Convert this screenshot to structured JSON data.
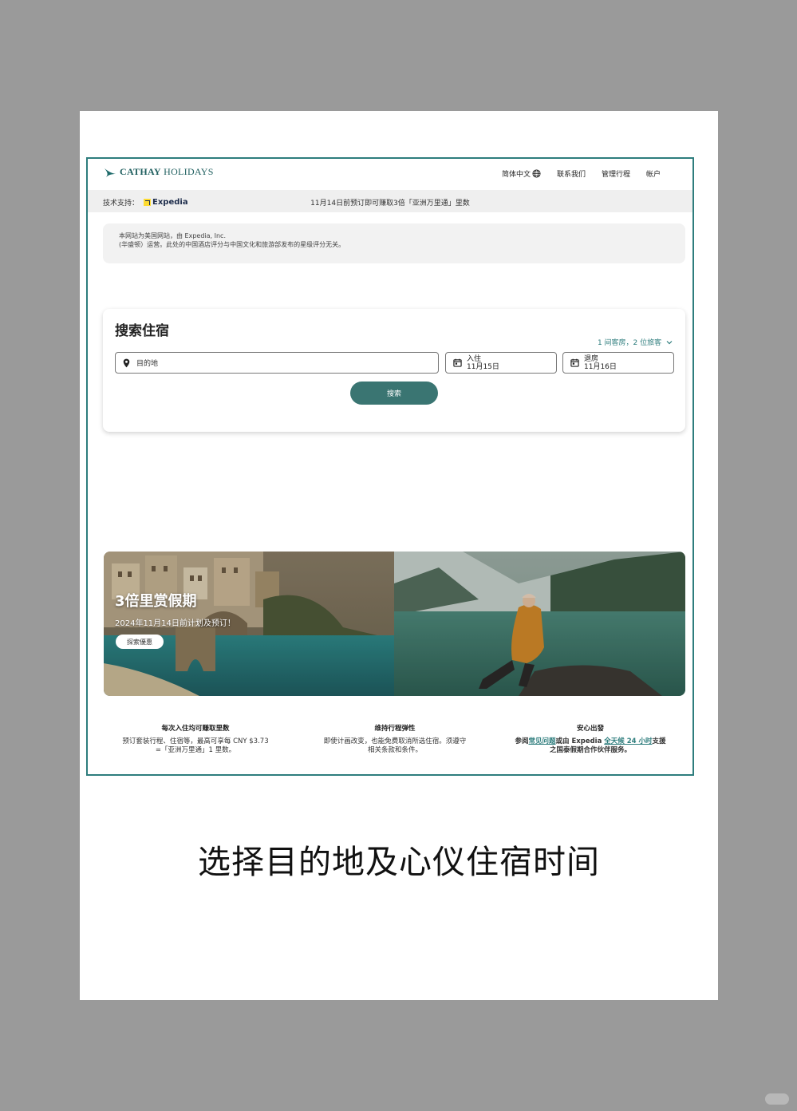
{
  "header": {
    "logo_bold": "CATHAY",
    "logo_rest": " HOLIDAYS",
    "nav": {
      "language": "简体中文",
      "contact": "联系我们",
      "manage": "管理行程",
      "account": "帐户"
    }
  },
  "subbar": {
    "powered_by": "技术支持：",
    "partner": "Expedia",
    "promo": "11月14日前预订即可赚取3倍「亚洲万里通」里数"
  },
  "notice": {
    "line1": "本网站为美国网站，由 Expedia, Inc.",
    "line2": "(华盛顿）运营。此处的中国酒店评分与中国文化和旅游部发布的星级评分无关。"
  },
  "search": {
    "title": "搜索住宿",
    "travelers": "1 间客房，2 位旅客",
    "destination_placeholder": "目的地",
    "checkin_label": "入住",
    "checkin_date": "11月15日",
    "checkout_label": "退房",
    "checkout_date": "11月16日",
    "button": "搜索"
  },
  "banner": {
    "title": "3倍里赏假期",
    "subtitle": "2024年11月14日前计划及预订！",
    "button": "探索優惠"
  },
  "features": [
    {
      "title": "每次入住均可赚取里数",
      "line1": "预订套装行程、住宿等，最高可享每 CNY $3.73",
      "line2": "=「亚洲万里通」1 里数。"
    },
    {
      "title": "维持行程弹性",
      "line1": "即使计画改变，也能免费取消所选住宿。须遵守",
      "line2": "相关条款和条件。"
    },
    {
      "title": "安心出發",
      "pre": "参阅",
      "link1": "常见问题",
      "mid": "或由 Expedia ",
      "link2": "全天候 24 小时",
      "post": "支援",
      "line2": "之国泰假期合作伙伴服务。"
    }
  ],
  "caption": "选择目的地及心仪住宿时间",
  "colors": {
    "teal": "#2e7d7d",
    "button": "#3a7572",
    "background": "#9a9a9a"
  }
}
